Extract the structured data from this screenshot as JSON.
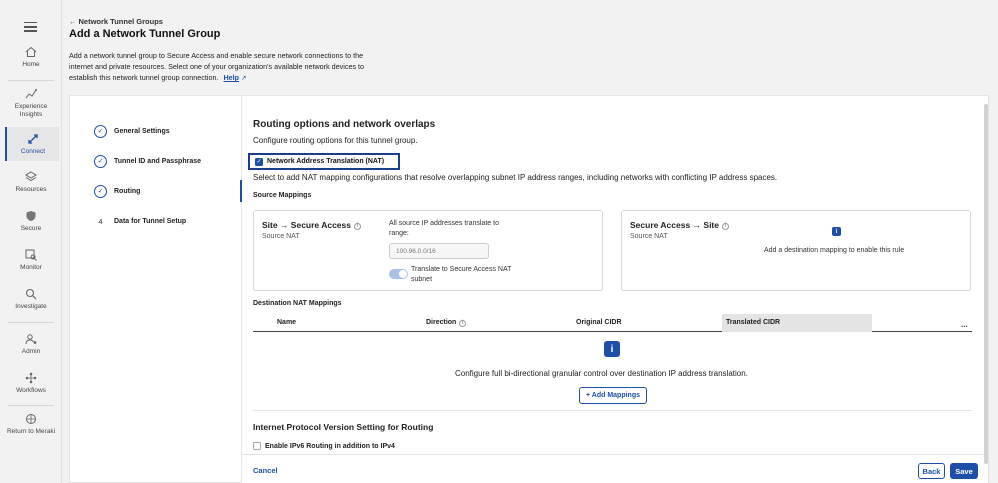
{
  "nav": {
    "items": [
      {
        "label": "Home"
      },
      {
        "label": "Experience Insights"
      },
      {
        "label": "Connect"
      },
      {
        "label": "Resources"
      },
      {
        "label": "Secure"
      },
      {
        "label": "Monitor"
      },
      {
        "label": "Investigate"
      },
      {
        "label": "Admin"
      },
      {
        "label": "Workflows"
      },
      {
        "label": "Return to Meraki"
      }
    ]
  },
  "header": {
    "back_label": "Network Tunnel Groups",
    "title": "Add a Network Tunnel Group",
    "description": "Add a network tunnel group to Secure Access and enable secure network connections to the internet and private resources. Select one of your organization's available network devices to establish this network tunnel group connection.",
    "help": "Help"
  },
  "steps": [
    {
      "label": "General Settings",
      "marker": "✓"
    },
    {
      "label": "Tunnel ID and Passphrase",
      "marker": "✓"
    },
    {
      "label": "Routing",
      "marker": "✓"
    },
    {
      "label": "Data for Tunnel Setup",
      "marker": "4"
    }
  ],
  "main": {
    "title": "Routing options and network overlaps",
    "subtitle": "Configure routing options for this tunnel group.",
    "nat_label": "Network Address Translation (NAT)",
    "nat_desc": "Select to add NAT mapping configurations that resolve overlapping subnet IP address ranges, including networks with conflicting IP address spaces.",
    "source_mappings": "Source Mappings",
    "panel_left": {
      "title": "Site → Secure Access",
      "sub": "Source NAT",
      "translate_label": "All source IP addresses translate to range:",
      "ip_placeholder": "100.96.0.0/16",
      "toggle_label": "Translate to Secure Access NAT subnet"
    },
    "panel_right": {
      "title": "Secure Access → Site",
      "sub": "Source NAT",
      "empty": "Add a destination mapping to enable this rule"
    },
    "dest_title": "Destination NAT Mappings",
    "columns": {
      "name": "Name",
      "direction": "Direction",
      "original": "Original CIDR",
      "translated": "Translated CIDR",
      "more": "..."
    },
    "empty_msg": "Configure full bi-directional granular control over destination IP address translation.",
    "add_button": "+ Add Mappings",
    "ip_title": "Internet Protocol Version Setting for Routing",
    "ipv6_label": "Enable IPv6 Routing in addition to IPv4"
  },
  "footer": {
    "cancel": "Cancel",
    "back": "Back",
    "save": "Save"
  },
  "colors": {
    "accent": "#1d4fa8",
    "highlight_border": "#1c3c8c"
  }
}
